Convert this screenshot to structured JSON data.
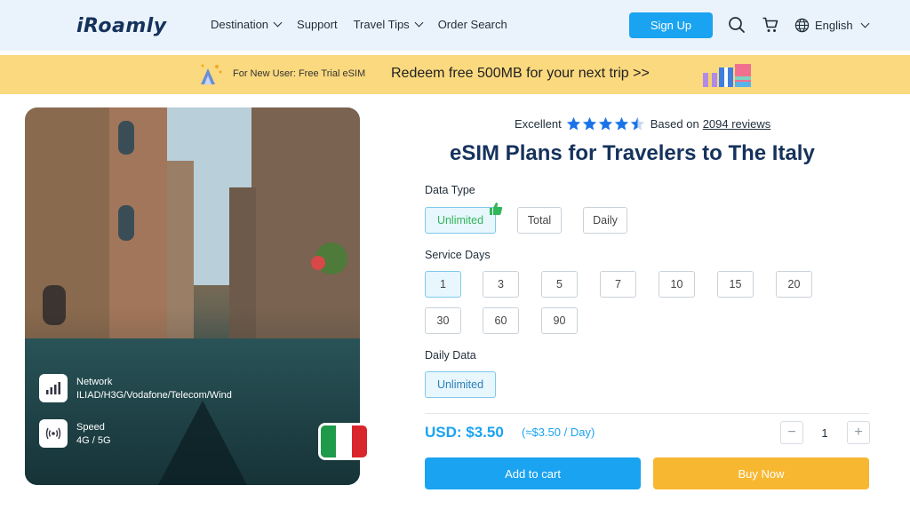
{
  "header": {
    "logo": "iRoamly",
    "nav": [
      {
        "label": "Destination",
        "has_chevron": true
      },
      {
        "label": "Support",
        "has_chevron": false
      },
      {
        "label": "Travel Tips",
        "has_chevron": true
      },
      {
        "label": "Order Search",
        "has_chevron": false
      }
    ],
    "signup_label": "Sign Up",
    "icons": [
      "search-icon",
      "cart-icon",
      "globe-icon"
    ],
    "language": "English"
  },
  "banner": {
    "small_text": "For New User: Free Trial eSIM",
    "big_text": "Redeem free 500MB for your next trip >>"
  },
  "hero": {
    "features": [
      {
        "title": "Network",
        "value": "ILIAD/H3G/Vodafone/Telecom/Wind",
        "icon": "signal-bars-icon"
      },
      {
        "title": "Speed",
        "value": "4G / 5G",
        "icon": "wifi-signal-icon"
      }
    ],
    "flag_colors": [
      "#1f9a4a",
      "#ffffff",
      "#d9262c"
    ]
  },
  "product": {
    "rating_label": "Excellent",
    "stars": 4.5,
    "reviews_prefix": "Based on",
    "reviews_link": "2094 reviews",
    "title": "eSIM Plans for Travelers to The Italy",
    "data_type_label": "Data Type",
    "data_types": [
      {
        "label": "Unlimited",
        "selected": true
      },
      {
        "label": "Total",
        "selected": false
      },
      {
        "label": "Daily",
        "selected": false
      }
    ],
    "service_days_label": "Service Days",
    "service_days": [
      "1",
      "3",
      "5",
      "7",
      "10",
      "15",
      "20",
      "30",
      "60",
      "90"
    ],
    "service_days_selected": "1",
    "daily_data_label": "Daily Data",
    "daily_data": [
      {
        "label": "Unlimited",
        "selected": true
      }
    ],
    "price": "USD: $3.50",
    "per_day": "(≈$3.50 / Day)",
    "quantity": "1",
    "qty_minus": "−",
    "qty_plus": "+",
    "add_to_cart": "Add to cart",
    "buy_now": "Buy Now"
  },
  "colors": {
    "accent_blue": "#1aa3f0",
    "buy_orange": "#f7b731",
    "banner_yellow": "#fbd97f",
    "header_bg": "#eaf3fb",
    "title_navy": "#15325c",
    "star_blue": "#1a73e8"
  }
}
